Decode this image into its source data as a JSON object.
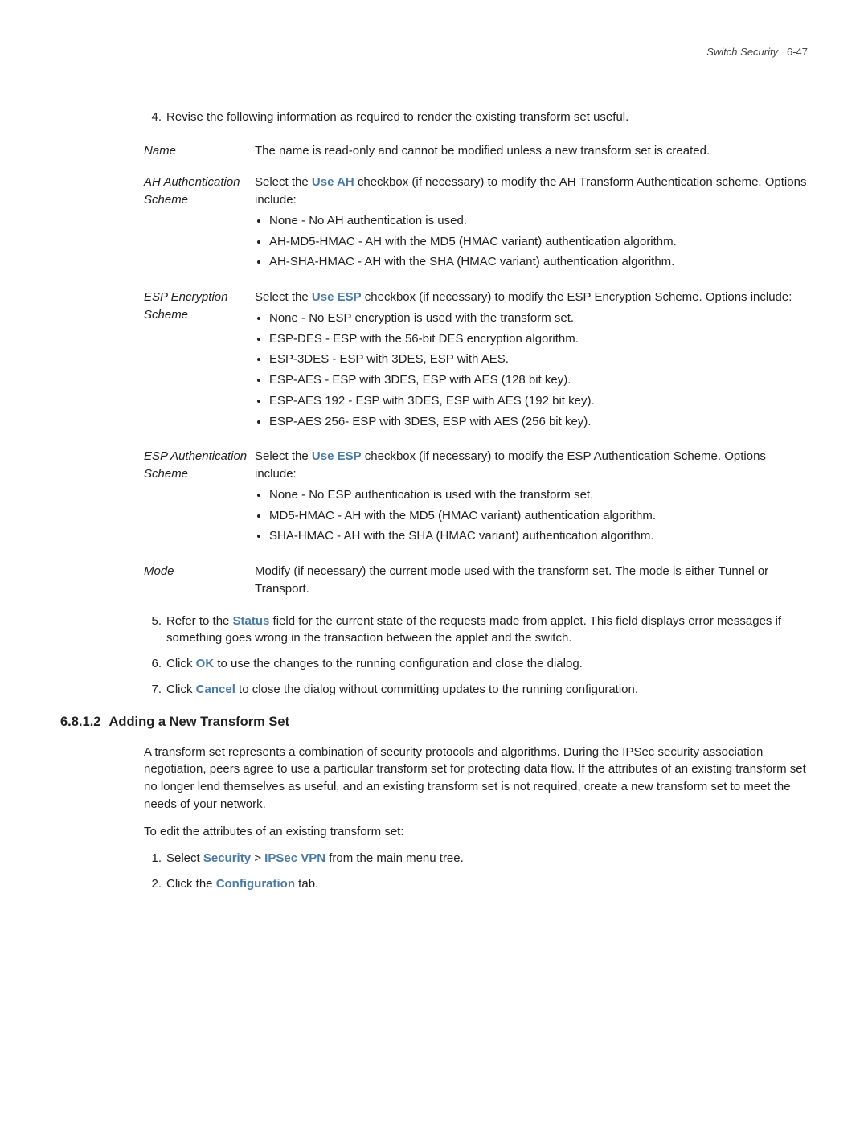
{
  "header": {
    "breadcrumb_label": "Switch Security",
    "page_ref": "6-47"
  },
  "step4": {
    "num": "4.",
    "text": "Revise the following information as required to render the existing transform set useful."
  },
  "defs": {
    "name": {
      "term": "Name",
      "desc": "The name is read-only and cannot be modified unless a new transform set is created."
    },
    "ah": {
      "term": "AH Authentication Scheme",
      "lead_pre": "Select the ",
      "lead_bold": "Use AH",
      "lead_post": " checkbox (if necessary) to modify the AH Transform Authentication scheme. Options include:",
      "items": [
        "None - No AH authentication is used.",
        "AH-MD5-HMAC - AH with the MD5 (HMAC variant) authentication algorithm.",
        "AH-SHA-HMAC - AH with the SHA (HMAC variant) authentication algorithm."
      ]
    },
    "esp_enc": {
      "term": "ESP Encryption Scheme",
      "lead_pre": "Select the ",
      "lead_bold": "Use ESP",
      "lead_post": " checkbox (if necessary) to modify the ESP Encryption Scheme. Options include:",
      "items": [
        "None - No ESP encryption is used with the transform set.",
        "ESP-DES - ESP with the 56-bit DES encryption algorithm.",
        "ESP-3DES - ESP with 3DES, ESP with AES.",
        "ESP-AES - ESP with 3DES, ESP with AES (128 bit key).",
        "ESP-AES 192 - ESP with 3DES, ESP with AES (192 bit key).",
        "ESP-AES 256- ESP with 3DES, ESP with AES (256 bit key)."
      ]
    },
    "esp_auth": {
      "term": "ESP Authentication Scheme",
      "lead_pre": "Select the ",
      "lead_bold": "Use ESP",
      "lead_post": " checkbox (if necessary) to modify the ESP Authentication Scheme. Options include:",
      "items": [
        "None - No ESP authentication is used with the transform set.",
        "MD5-HMAC - AH with the MD5 (HMAC variant) authentication algorithm.",
        "SHA-HMAC - AH with the SHA (HMAC variant) authentication algorithm."
      ]
    },
    "mode": {
      "term": "Mode",
      "desc": "Modify (if necessary) the current mode used with the transform set. The mode is either Tunnel or Transport."
    }
  },
  "step5": {
    "num": "5.",
    "pre": "Refer to the ",
    "bold": "Status",
    "post": " field for the current state of the requests made from applet. This field displays error messages if something goes wrong in the transaction between the applet and the switch."
  },
  "step6": {
    "num": "6.",
    "pre": "Click ",
    "bold": "OK",
    "post": " to use the changes to the running configuration and close the dialog."
  },
  "step7": {
    "num": "7.",
    "pre": "Click ",
    "bold": "Cancel",
    "post": " to close the dialog without committing updates to the running configuration."
  },
  "section": {
    "num": "6.8.1.2",
    "title": "Adding a New Transform Set",
    "p1": "A transform set represents a combination of security protocols and algorithms. During the IPSec security association negotiation, peers agree to use a particular transform set for protecting data flow. If the attributes of an existing transform set no longer lend themselves as useful, and an existing transform set is not required, create a new transform set to meet the needs of your network.",
    "p2": "To edit the attributes of an existing transform set:",
    "s1": {
      "num": "1.",
      "pre": "Select ",
      "b1": "Security",
      "mid": " > ",
      "b2": "IPSec VPN",
      "post": " from the main menu tree."
    },
    "s2": {
      "num": "2.",
      "pre": "Click the ",
      "bold": "Configuration",
      "post": " tab."
    }
  }
}
